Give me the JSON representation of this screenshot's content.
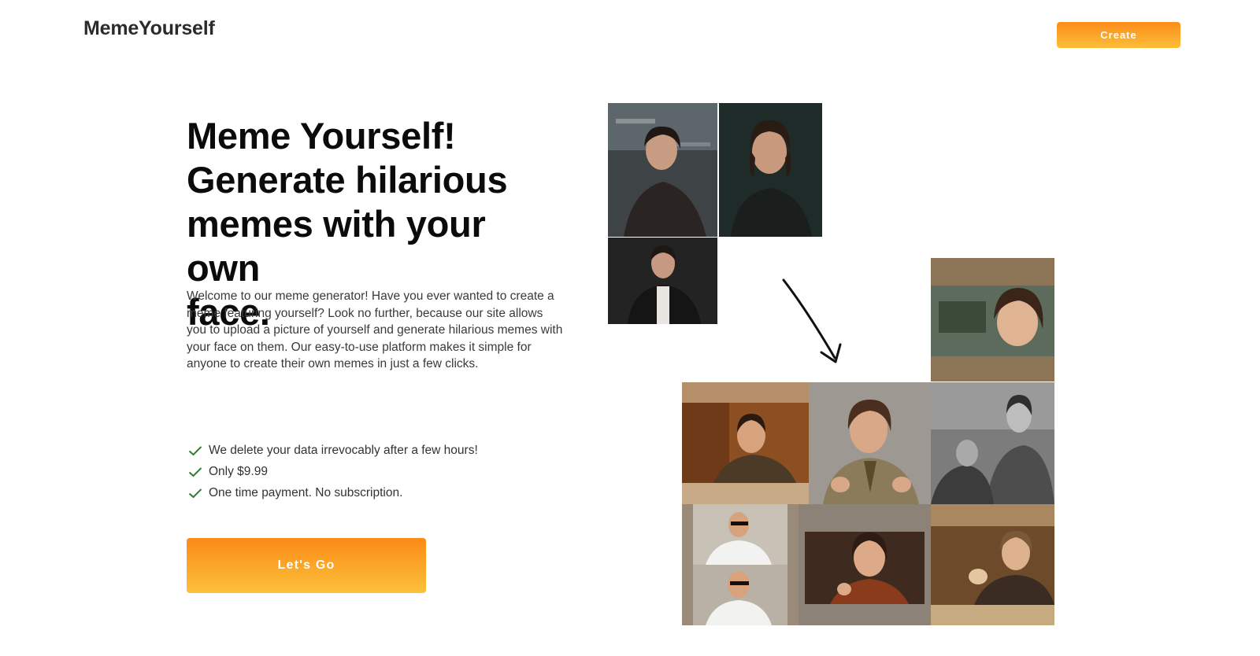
{
  "header": {
    "brand": "MemeYourself",
    "create_label": "Create"
  },
  "hero": {
    "headline_lines": [
      "Meme Yourself!",
      "Generate hilarious",
      "memes with your own",
      "face."
    ],
    "intro": "Welcome to our meme generator! Have you ever wanted to create a meme featuring yourself? Look no further, because our site allows you to upload a picture of yourself and generate hilarious memes with your face on them. Our easy-to-use platform makes it simple for anyone to create their own memes in just a few clicks.",
    "features": [
      "We delete your data irrevocably after a few hours!",
      "Only $9.99",
      "One time payment. No subscription."
    ],
    "cta_label": "Let's Go"
  },
  "colors": {
    "accent_top": "#fb8a16",
    "accent_bottom": "#fdc13b",
    "check": "#2e7d32"
  },
  "icons": {
    "check": "check-icon",
    "arrow": "arrow-down-right-icon"
  },
  "collage": {
    "source_photos": [
      "source photo 1",
      "source photo 2",
      "source photo 3"
    ],
    "meme_results": [
      "meme result 1",
      "meme result 2",
      "meme result 3",
      "meme result 4",
      "meme result 5",
      "meme result 6",
      "meme result 7",
      "meme result 8"
    ]
  }
}
